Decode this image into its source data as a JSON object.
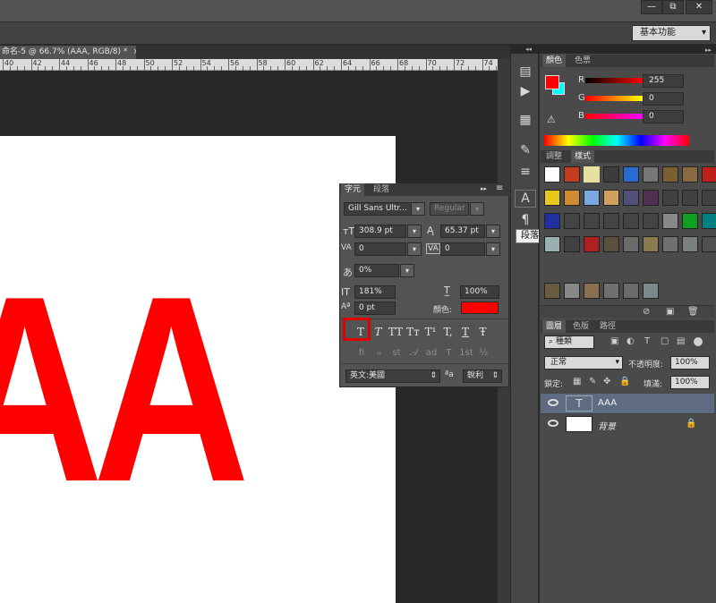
{
  "window": {
    "min_label": "—",
    "restore_label": "⧉",
    "close_label": "✕"
  },
  "options_bar": {
    "workspace": "基本功能",
    "workspace_arrow": "▾"
  },
  "document": {
    "tab_title": "命名-5 @ 66.7% (AAA, RGB/8) *",
    "tab_close": "×",
    "canvas_text": "AA"
  },
  "ruler": {
    "labels": [
      "40",
      "42",
      "44",
      "46",
      "48",
      "50",
      "52",
      "54",
      "56",
      "58",
      "60",
      "62",
      "64",
      "66",
      "68",
      "70",
      "72",
      "74"
    ]
  },
  "toolstrip": {
    "collapse": "◂◂",
    "tooltip": "段落"
  },
  "color_panel": {
    "tabs": [
      "顏色",
      "色票"
    ],
    "channels": [
      {
        "label": "R",
        "value": "255",
        "color": "#ff0000"
      },
      {
        "label": "G",
        "value": "0",
        "color": "#00ff00"
      },
      {
        "label": "B",
        "value": "0",
        "color": "#0000ff"
      }
    ],
    "foreground": "#ff0000",
    "background": "#00ffff"
  },
  "styles_panel": {
    "tabs": [
      "調整",
      "樣式"
    ]
  },
  "character_panel": {
    "tabs": [
      "字元",
      "段落"
    ],
    "font_family": "Gill Sans Ultr...",
    "font_style": "Regular",
    "font_size": "308.9 pt",
    "leading": "65.37 pt",
    "kerning": "0",
    "tracking": "0",
    "tsume": "0%",
    "vertical_scale": "181%",
    "horizontal_scale": "100%",
    "baseline_shift": "0 pt",
    "color_label": "顏色:",
    "color": "#ff0000",
    "format_buttons": [
      "T",
      "T",
      "TT",
      "Tт",
      "T¹",
      "T,",
      "T",
      "Ŧ"
    ],
    "opentype_buttons": [
      "fi",
      "ℴ",
      "st",
      "𝒜",
      "ad",
      "T",
      "1st",
      "½"
    ],
    "language": "英文:美國",
    "aa_label": "ªa",
    "antialias": "銳利",
    "menu_icon": "▸▸",
    "caret": "▾"
  },
  "layers_panel": {
    "tabs": [
      "圖層",
      "色版",
      "路徑"
    ],
    "filter": "種類",
    "blend_mode": "正常",
    "opacity_label": "不透明度:",
    "opacity": "100%",
    "lock_label": "鎖定:",
    "fill_label": "填滿:",
    "fill": "100%",
    "layers": [
      {
        "name": "AAA",
        "type": "text",
        "thumb": "T",
        "selected": true
      },
      {
        "name": "背景",
        "type": "background",
        "thumb": "",
        "locked": true
      }
    ]
  }
}
